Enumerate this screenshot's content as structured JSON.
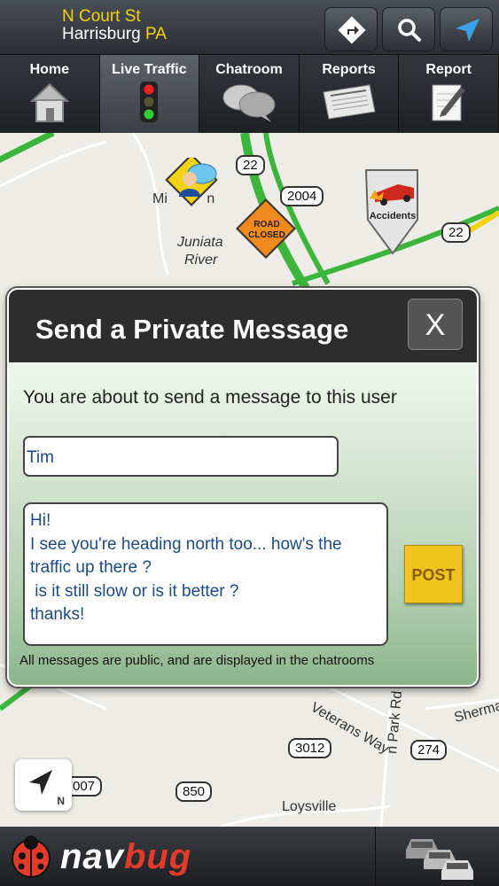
{
  "header": {
    "street": "N Court St",
    "city": "Harrisburg",
    "state": "PA",
    "buttons": [
      {
        "name": "directions-icon"
      },
      {
        "name": "search-icon"
      },
      {
        "name": "location-arrow-icon"
      }
    ]
  },
  "tabs": [
    {
      "label": "Home",
      "icon": "house-icon",
      "active": false
    },
    {
      "label": "Live Traffic",
      "icon": "traffic-light-icon",
      "active": true
    },
    {
      "label": "Chatroom",
      "icon": "chat-bubbles-icon",
      "active": false
    },
    {
      "label": "Reports",
      "icon": "newspaper-icon",
      "active": false
    },
    {
      "label": "Report",
      "icon": "notepad-pencil-icon",
      "active": false
    }
  ],
  "map": {
    "labels": {
      "town1": "Mi",
      "town1_end": "n",
      "river1": "Juniata",
      "river2": "River",
      "street1": "Veterans Way",
      "street2": "Sherma",
      "street3": "n Park Rd",
      "town2": "Loysville"
    },
    "shields": {
      "r22a": "22",
      "r2004": "2004",
      "r22b": "22",
      "r3012": "3012",
      "r274": "274",
      "r850": "850",
      "r007": "007"
    },
    "markers": {
      "road_closed_line1": "ROAD",
      "road_closed_line2": "CLOSED",
      "accidents": "Accidents"
    }
  },
  "dialog": {
    "title": "Send a Private Message",
    "close_label": "X",
    "intro": "You are about to send a message to this user",
    "recipient": "Tim",
    "message": "Hi!\nI see you're heading north too... how's the traffic up there ?\n is it still slow or is it better ?\nthanks!",
    "post_label": "POST",
    "note": "All messages are public, and are displayed in the chatrooms"
  },
  "compass": {
    "label": "N"
  },
  "bottom": {
    "brand_part1": "nav",
    "brand_part2": "bug",
    "right_icon": "traffic-cars-icon"
  },
  "colors": {
    "accent_yellow": "#f1d312",
    "traffic_green": "#3cb53c",
    "brand_red": "#e33b2b",
    "post_button": "#f0c41c"
  }
}
